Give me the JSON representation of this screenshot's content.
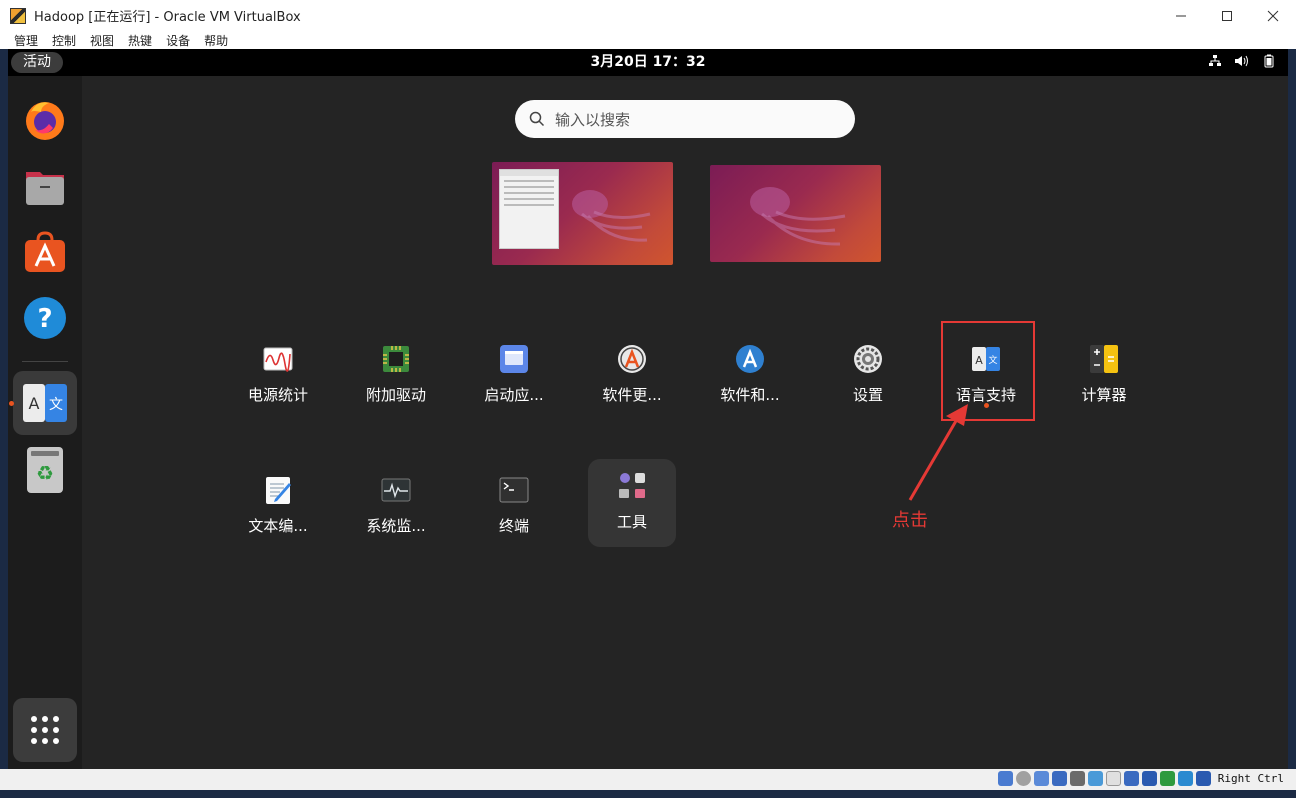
{
  "window": {
    "title": "Hadoop [正在运行] - Oracle VM VirtualBox"
  },
  "menubar": [
    "管理",
    "控制",
    "视图",
    "热键",
    "设备",
    "帮助"
  ],
  "topbar": {
    "activities": "活动",
    "clock": "3月20日 17：32"
  },
  "dock": {
    "items": [
      {
        "name": "firefox-icon"
      },
      {
        "name": "files-icon"
      },
      {
        "name": "app-center-icon"
      },
      {
        "name": "help-icon"
      },
      {
        "name": "language-support-icon"
      },
      {
        "name": "trash-icon"
      }
    ],
    "show_apps": "show-apps-grid-icon"
  },
  "search": {
    "placeholder": "输入以搜索"
  },
  "apps": [
    {
      "label": "电源统计",
      "icon": "power-statistics-icon"
    },
    {
      "label": "附加驱动",
      "icon": "additional-drivers-icon"
    },
    {
      "label": "启动应...",
      "icon": "startup-applications-icon"
    },
    {
      "label": "软件更...",
      "icon": "software-updater-icon"
    },
    {
      "label": "软件和...",
      "icon": "software-sources-icon"
    },
    {
      "label": "设置",
      "icon": "settings-icon"
    },
    {
      "label": "语言支持",
      "icon": "language-support-icon"
    },
    {
      "label": "计算器",
      "icon": "calculator-icon"
    },
    {
      "label": "文本编...",
      "icon": "text-editor-icon"
    },
    {
      "label": "系统监...",
      "icon": "system-monitor-icon"
    },
    {
      "label": "终端",
      "icon": "terminal-icon"
    },
    {
      "label": "工具",
      "icon": "utilities-folder-icon"
    }
  ],
  "annotation": {
    "text": "点击",
    "color": "#e53935"
  },
  "statusbar": {
    "host_key": "Right Ctrl"
  },
  "colors": {
    "accent": "#e95420",
    "overview_bg": "#242424",
    "annotation": "#e53935"
  }
}
